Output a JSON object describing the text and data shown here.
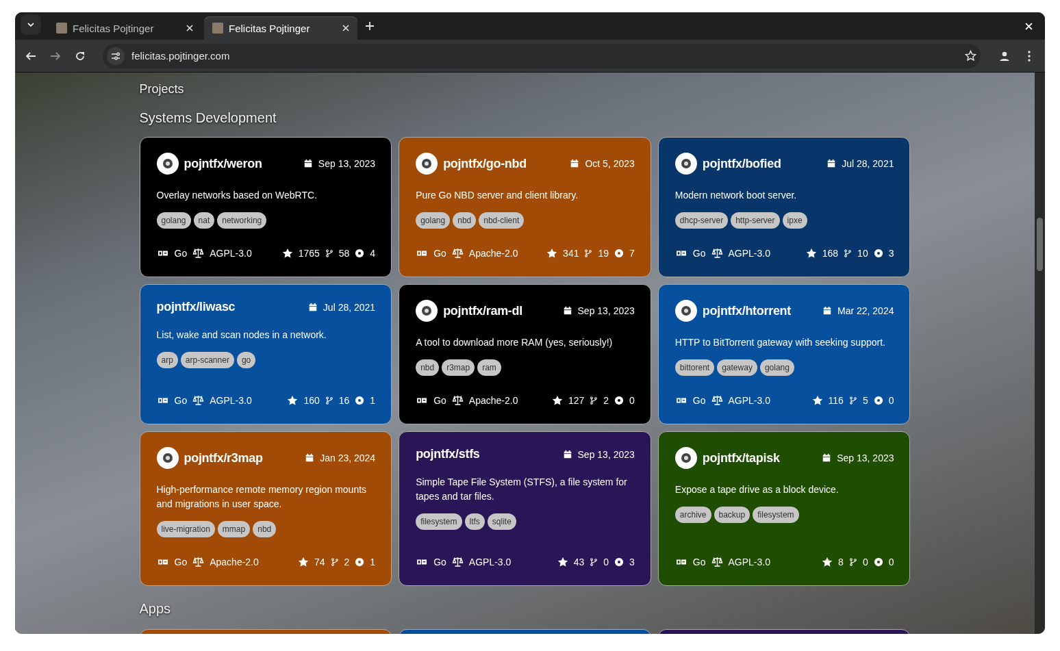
{
  "browser": {
    "tabs": [
      {
        "title": "Felicitas Pojtinger",
        "selected": false
      },
      {
        "title": "Felicitas Pojtinger",
        "selected": true
      }
    ],
    "address": "felicitas.pojtinger.com"
  },
  "page": {
    "heading": "Projects",
    "section": "Systems Development",
    "cards": [
      {
        "name": "pojntfx/weron",
        "logo": true,
        "date": "Sep 13, 2023",
        "description": "Overlay networks based on WebRTC.",
        "tags": [
          "golang",
          "nat",
          "networking"
        ],
        "language": "Go",
        "license": "AGPL-3.0",
        "stars": "1765",
        "forks": "58",
        "issues": "4",
        "color": "#000000"
      },
      {
        "name": "pojntfx/go-nbd",
        "logo": true,
        "date": "Oct 5, 2023",
        "description": "Pure Go NBD server and client library.",
        "tags": [
          "golang",
          "nbd",
          "nbd-client"
        ],
        "language": "Go",
        "license": "Apache-2.0",
        "stars": "341",
        "forks": "19",
        "issues": "7",
        "color": "#a24b06"
      },
      {
        "name": "pojntfx/bofied",
        "logo": true,
        "date": "Jul 28, 2021",
        "description": "Modern network boot server.",
        "tags": [
          "dhcp-server",
          "http-server",
          "ipxe"
        ],
        "language": "Go",
        "license": "AGPL-3.0",
        "stars": "168",
        "forks": "10",
        "issues": "3",
        "color": "#08366a"
      },
      {
        "name": "pojntfx/liwasc",
        "logo": false,
        "date": "Jul 28, 2021",
        "description": "List, wake and scan nodes in a network.",
        "tags": [
          "arp",
          "arp-scanner",
          "go"
        ],
        "language": "Go",
        "license": "AGPL-3.0",
        "stars": "160",
        "forks": "16",
        "issues": "1",
        "color": "#06509e"
      },
      {
        "name": "pojntfx/ram-dl",
        "logo": true,
        "date": "Sep 13, 2023",
        "description": "A tool to download more RAM (yes, seriously!)",
        "tags": [
          "nbd",
          "r3map",
          "ram"
        ],
        "language": "Go",
        "license": "Apache-2.0",
        "stars": "127",
        "forks": "2",
        "issues": "0",
        "color": "#000000"
      },
      {
        "name": "pojntfx/htorrent",
        "logo": true,
        "date": "Mar 22, 2024",
        "description": "HTTP to BitTorrent gateway with seeking support.",
        "tags": [
          "bittorent",
          "gateway",
          "golang"
        ],
        "language": "Go",
        "license": "AGPL-3.0",
        "stars": "116",
        "forks": "5",
        "issues": "0",
        "color": "#06509e"
      },
      {
        "name": "pojntfx/r3map",
        "logo": true,
        "date": "Jan 23, 2024",
        "description": "High-performance remote memory region mounts and migrations in user space.",
        "tags": [
          "live-migration",
          "mmap",
          "nbd"
        ],
        "language": "Go",
        "license": "Apache-2.0",
        "stars": "74",
        "forks": "2",
        "issues": "1",
        "color": "#a24b06"
      },
      {
        "name": "pojntfx/stfs",
        "logo": false,
        "date": "Sep 13, 2023",
        "description": "Simple Tape File System (STFS), a file system for tapes and tar files.",
        "tags": [
          "filesystem",
          "ltfs",
          "sqlite"
        ],
        "language": "Go",
        "license": "AGPL-3.0",
        "stars": "43",
        "forks": "0",
        "issues": "3",
        "color": "#2a1656"
      },
      {
        "name": "pojntfx/tapisk",
        "logo": true,
        "date": "Sep 13, 2023",
        "description": "Expose a tape drive as a block device.",
        "tags": [
          "archive",
          "backup",
          "filesystem"
        ],
        "language": "Go",
        "license": "AGPL-3.0",
        "stars": "8",
        "forks": "0",
        "issues": "0",
        "color": "#1f4d01"
      }
    ],
    "apps": {
      "title": "Apps",
      "cards": [
        {
          "color": "#a24b06"
        },
        {
          "color": "#06509e"
        },
        {
          "color": "#2a1656"
        }
      ]
    }
  }
}
